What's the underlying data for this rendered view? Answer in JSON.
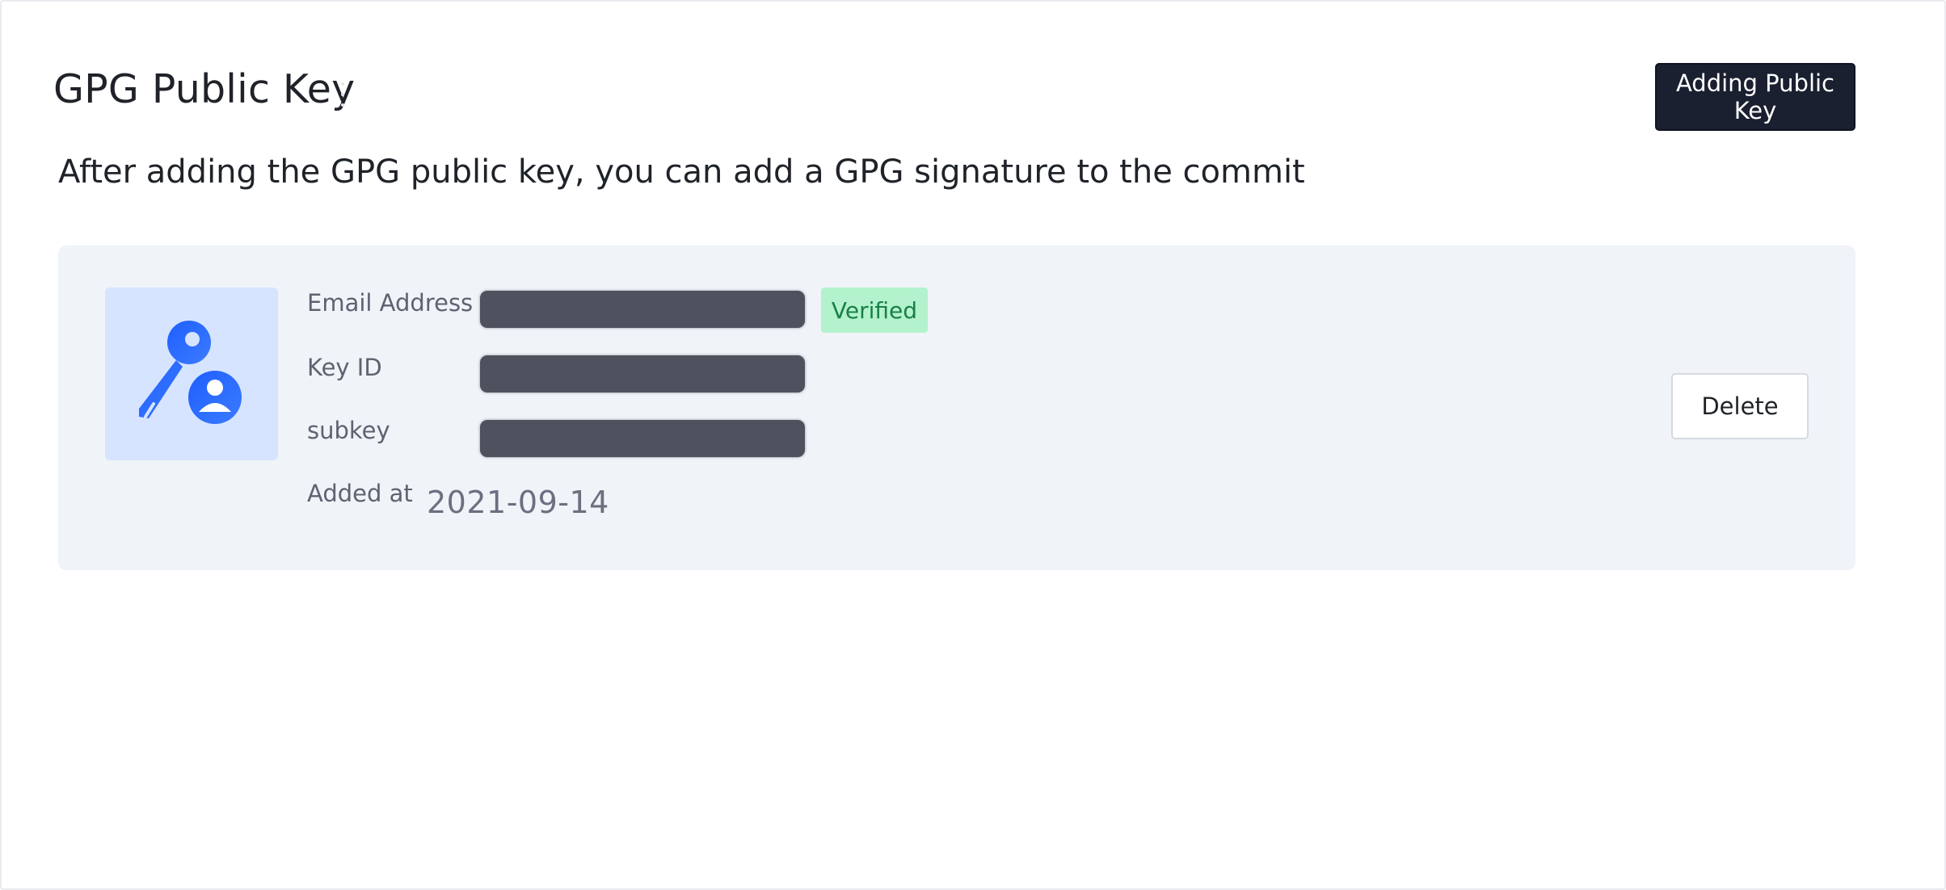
{
  "header": {
    "title": "GPG Public Key",
    "add_button_label": "Adding Public Key"
  },
  "description": "After adding the GPG public key, you can add a GPG signature to the commit",
  "key_card": {
    "icon": "key-user-icon",
    "fields": {
      "email_label": "Email Address",
      "key_id_label": "Key ID",
      "subkey_label": "subkey",
      "added_label": "Added at"
    },
    "verified_badge": "Verified",
    "added_date": "2021-09-14",
    "delete_button_label": "Delete"
  },
  "colors": {
    "primary_button": "#1b2030",
    "card_background": "#f0f3f8",
    "icon_background": "#d6e4ff",
    "icon_blue": "#1f5fff",
    "verified_background": "#b3f2cd",
    "verified_text": "#1a7f4a",
    "masked_value": "#4e525e"
  }
}
